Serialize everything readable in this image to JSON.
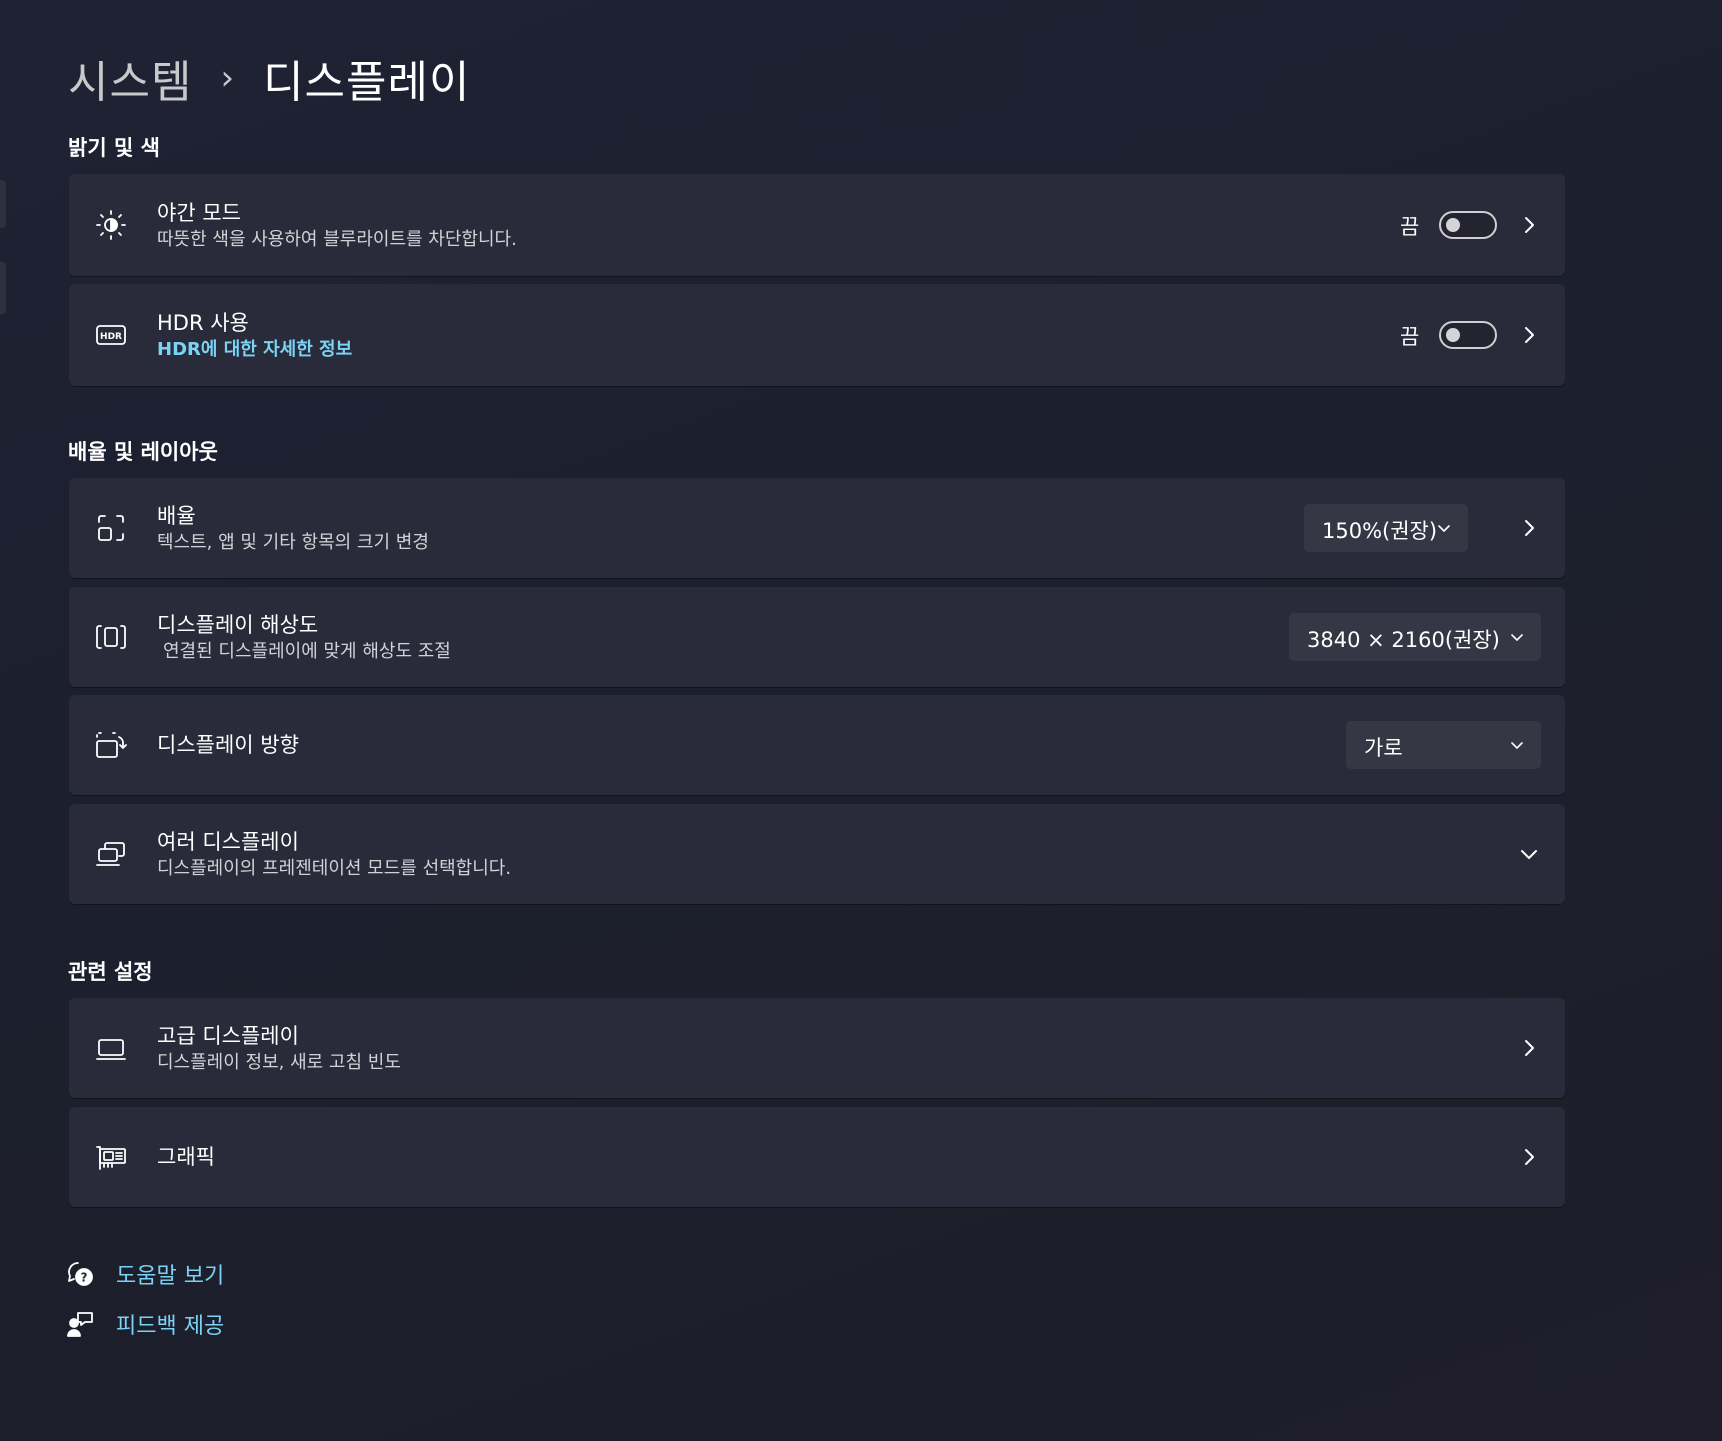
{
  "breadcrumb": {
    "parent": "시스템",
    "separator": "›",
    "current": "디스플레이"
  },
  "sections": {
    "brightness": "밝기 및 색",
    "scale_layout": "배율 및 레이아웃",
    "related": "관련 설정"
  },
  "night_mode": {
    "title": "야간 모드",
    "subtitle": "따뜻한 색을 사용하여 블루라이트를 차단합니다.",
    "state_label": "끔",
    "toggle_on": false,
    "icon": "brightness-icon"
  },
  "hdr": {
    "title": "HDR 사용",
    "link": "HDR에 대한 자세한 정보",
    "state_label": "끔",
    "toggle_on": false,
    "icon": "hdr-icon"
  },
  "scale": {
    "title": "배율",
    "subtitle": "텍스트, 앱 및 기타 항목의 크기 변경",
    "value": "150%(권장)",
    "icon": "scale-icon"
  },
  "resolution": {
    "title": "디스플레이 해상도",
    "subtitle": "연결된 디스플레이에 맞게 해상도 조절",
    "value": "3840 × 2160(권장)",
    "icon": "resolution-icon"
  },
  "orientation": {
    "title": "디스플레이 방향",
    "value": "가로",
    "icon": "orientation-icon"
  },
  "multi_display": {
    "title": "여러 디스플레이",
    "subtitle": "디스플레이의 프레젠테이션 모드를 선택합니다.",
    "icon": "multi-display-icon"
  },
  "advanced_display": {
    "title": "고급 디스플레이",
    "subtitle": "디스플레이 정보, 새로 고침 빈도",
    "icon": "laptop-icon"
  },
  "graphics": {
    "title": "그래픽",
    "icon": "graphics-card-icon"
  },
  "footer": {
    "help": "도움말 보기",
    "feedback": "피드백 제공"
  },
  "colors": {
    "accent_link": "#7ad2f5",
    "card_bg": "#2a2b3a",
    "page_bg": "#1e2233"
  }
}
